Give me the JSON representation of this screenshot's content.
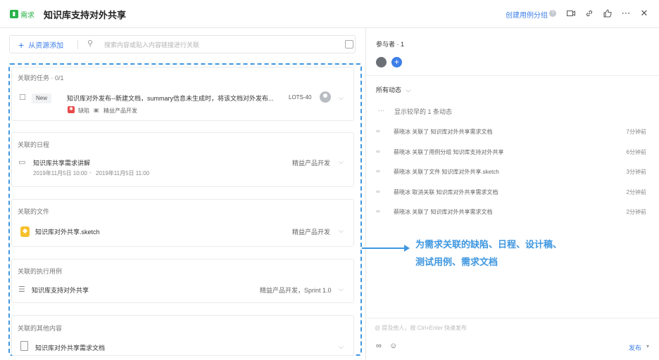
{
  "header": {
    "badge_label": "需求",
    "title": "知识库支持对外共享",
    "link_label": "创建用例分组",
    "icons": [
      "help-icon",
      "video-icon",
      "link-icon",
      "thumbs-up-icon",
      "more-icon",
      "close-icon"
    ]
  },
  "search": {
    "add_label": "从资源添加",
    "placeholder": "搜索内容或贴入内容链接进行关联"
  },
  "tasks": {
    "title": "关联的任务 · 0/1",
    "tag": "New",
    "name": "知识库对外发布--新建文档，summary信息未生成时，将该文档对外发布...",
    "id": "LOTS-40",
    "type": "缺陷",
    "project": "精益产品开发"
  },
  "schedule": {
    "title": "关联的日程",
    "name": "知识库共享需求讲解",
    "time_start": "2019年11月5日 10:00",
    "time_sep": "-",
    "time_end": "2019年11月5日 11:00",
    "project": "精益产品开发"
  },
  "files": {
    "title": "关联的文件",
    "name": "知识库对外共享.sketch",
    "project": "精益产品开发"
  },
  "testcases": {
    "title": "关联的执行用例",
    "name": "知识库支持对外共享",
    "project": "精益产品开发，Sprint 1.0"
  },
  "others": {
    "title": "关联的其他内容",
    "name": "知识库对外共享需求文档"
  },
  "participants": {
    "title": "参与者 · 1"
  },
  "activity": {
    "filter_label": "所有动态",
    "show_earlier": "显示较早的 1 条动态",
    "items": [
      {
        "text": "蔡晓冰 关联了 知识库对外共享需求文档",
        "time": "7分钟前"
      },
      {
        "text": "蔡晓冰 关联了用例分组 知识库支持对外共享",
        "time": "6分钟前"
      },
      {
        "text": "蔡晓冰 关联了文件 知识库对外共享.sketch",
        "time": "3分钟前"
      },
      {
        "text": "蔡晓冰 取消关联 知识库对外共享需求文档",
        "time": "2分钟前"
      },
      {
        "text": "蔡晓冰 关联了 知识库对外共享需求文档",
        "time": "2分钟前"
      }
    ]
  },
  "annotation": {
    "line1": "为需求关联的缺陷、日程、设计稿、",
    "line2": "测试用例、需求文档"
  },
  "comment": {
    "placeholder": "@ 提及他人，按 Ctrl+Enter 快速发布",
    "publish_label": "发布"
  },
  "colors": {
    "accent": "#3d7fe8",
    "badge": "#29b24a",
    "highlight": "#3f97e0",
    "bug": "#e84a4a",
    "sketch": "#f7c02d"
  }
}
